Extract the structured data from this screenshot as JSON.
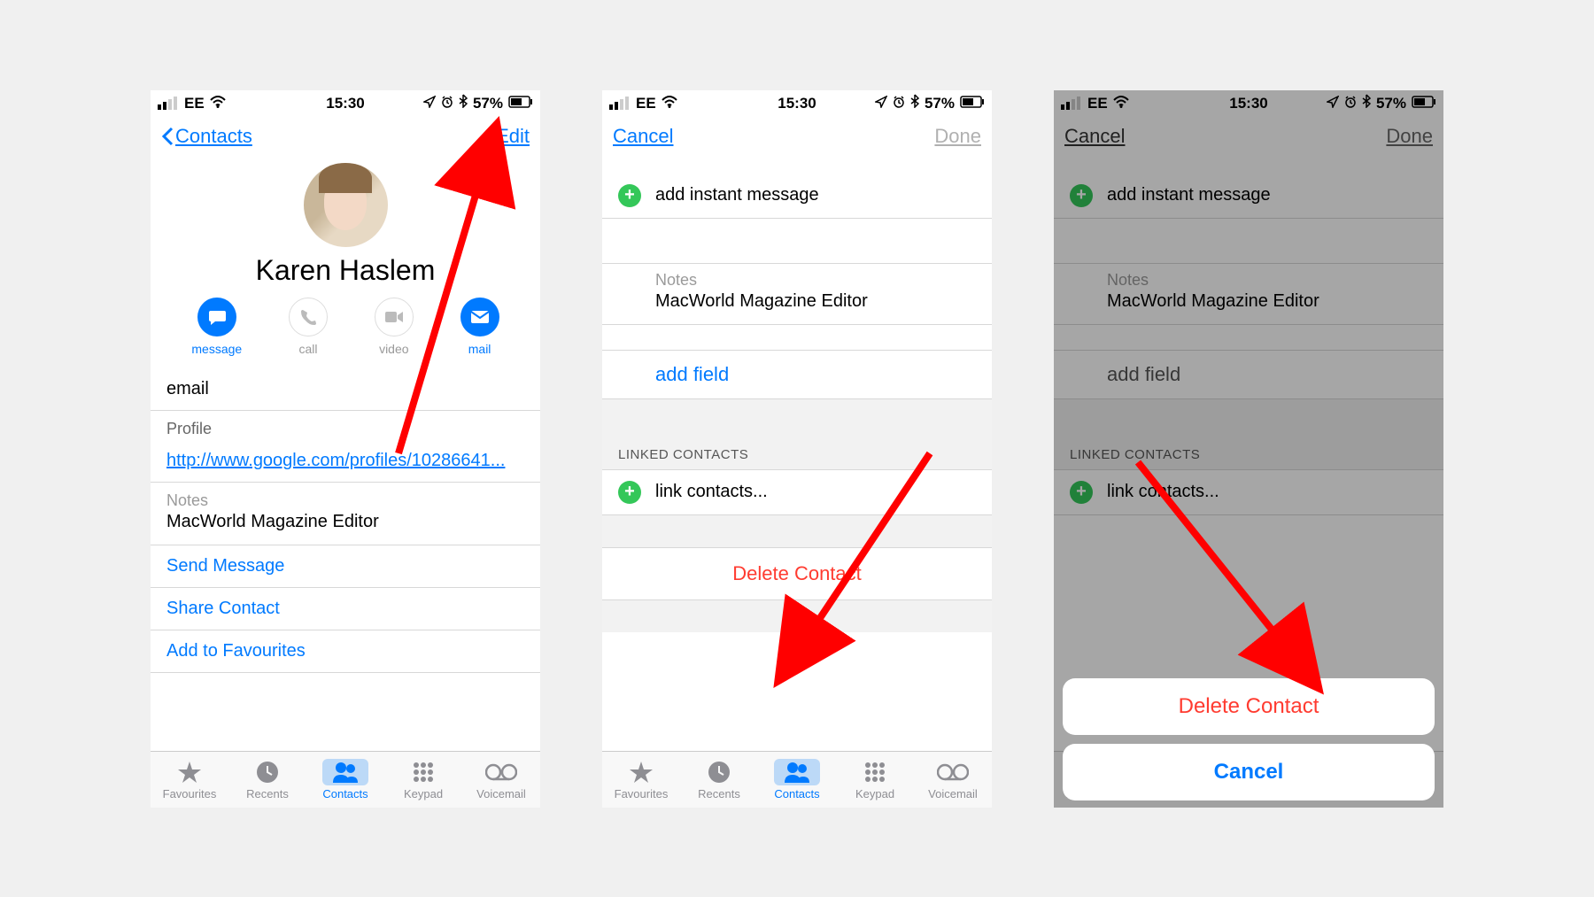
{
  "status": {
    "carrier": "EE",
    "time": "15:30",
    "battery": "57%"
  },
  "screen1": {
    "nav": {
      "back": "Contacts",
      "edit": "Edit"
    },
    "contact_name": "Karen Haslem",
    "actions": {
      "message": "message",
      "call": "call",
      "video": "video",
      "mail": "mail"
    },
    "email_label": "email",
    "profile_label": "Profile",
    "profile_url": "http://www.google.com/profiles/10286641...",
    "notes_label": "Notes",
    "notes_val": "MacWorld Magazine Editor",
    "send_message": "Send Message",
    "share_contact": "Share Contact",
    "add_fav": "Add to Favourites"
  },
  "screen2": {
    "nav": {
      "cancel": "Cancel",
      "done": "Done"
    },
    "add_im": "add instant message",
    "notes_label": "Notes",
    "notes_val": "MacWorld Magazine Editor",
    "add_field": "add field",
    "linked_header": "LINKED CONTACTS",
    "link_contacts": "link contacts...",
    "delete": "Delete Contact"
  },
  "screen3": {
    "nav": {
      "cancel": "Cancel",
      "done": "Done"
    },
    "add_im": "add instant message",
    "notes_label": "Notes",
    "notes_val": "MacWorld Magazine Editor",
    "add_field": "add field",
    "linked_header": "LINKED CONTACTS",
    "link_contacts": "link contacts...",
    "sheet": {
      "delete": "Delete Contact",
      "cancel": "Cancel"
    }
  },
  "tabs": {
    "favourites": "Favourites",
    "recents": "Recents",
    "contacts": "Contacts",
    "keypad": "Keypad",
    "voicemail": "Voicemail"
  }
}
